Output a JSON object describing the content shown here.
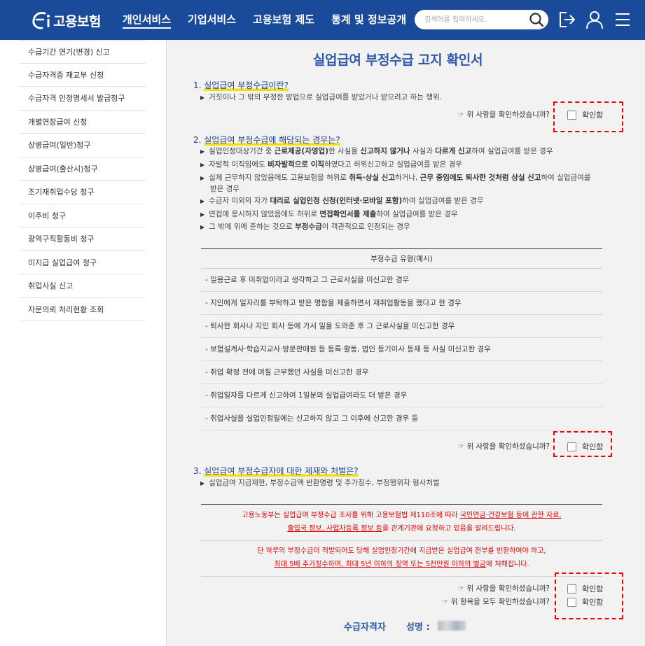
{
  "header": {
    "logo_text": "고용보험",
    "nav": [
      "개인서비스",
      "기업서비스",
      "고용보험 제도",
      "통계 및 정보공개"
    ],
    "search_placeholder": "검색어를 입력하세요."
  },
  "sidebar": {
    "items": [
      "수급기간 연기(변경) 신고",
      "수급자격증 재교부 신청",
      "수급자격 인정명세서 발급청구",
      "개별연장급여 신청",
      "상병급여(일반)청구",
      "상병급여(출산시)청구",
      "조기재취업수당 청구",
      "이주비 청구",
      "광역구직활동비 청구",
      "미지급 실업급여 청구",
      "취업사실 신고",
      "자문의뢰 처리현황 조회"
    ]
  },
  "main": {
    "title": "실업급여 부정수급 고지 확인서",
    "confirm_question": "☞ 위 사항을 확인하셨습니까?",
    "confirm_label": "확인함",
    "confirm_all_question": "☞ 위 항목을 모두 확인하셨습니까?",
    "section1": {
      "num": "1. ",
      "title": "실업급여 부정수급이란?",
      "bullets": [
        "거짓이나 그 밖의 부정한 방법으로 실업급여를 받았거나 받으려고 하는 행위."
      ]
    },
    "section2": {
      "num": "2. ",
      "title": "실업급여 부정수급에 해당되는 경우는?",
      "b1_a": "실업인정대상기간 중 ",
      "b1_b": "근로제공(자영업)",
      "b1_c": "한 사실을 ",
      "b1_d": "신고하지 않거나",
      "b1_e": " 사실과 ",
      "b1_f": "다르게 신고",
      "b1_g": "하여 실업급여를 받은 경우",
      "b2_a": "자발적 이직임에도 ",
      "b2_b": "비자발적으로 이직",
      "b2_c": "하였다고 허위신고하고 실업급여를 받은 경우",
      "b3_a": "실제 근무하지 않았음에도 고용보험을 허위로 ",
      "b3_b": "취득·상실 신고",
      "b3_c": "하거나, ",
      "b3_d": "근무 중임에도 퇴사한 것처럼 상실 신고",
      "b3_e": "하여 실업급여를",
      "b3_f": "받은 경우",
      "b4_a": "수급자 이외의 자가 ",
      "b4_b": "대리로 실업인정 신청",
      "b4_c": "(인터넷·모바일 포함)",
      "b4_d": "하여 실업급여를 받은 경우",
      "b5_a": "면접에 응시하지 않았음에도 허위로 ",
      "b5_b": "면접확인서를 제출",
      "b5_c": "하여 실업급여를 받은 경우",
      "b6_a": "그 밖에 위에 준하는 것으로 ",
      "b6_b": "부정수급",
      "b6_c": "이 객관적으로 인정되는 경우",
      "table_header": "부정수급 유형(예시)",
      "table_rows": [
        "- 일용근로 후 미취업이라고 생각하고 그 근로사실을 미신고한 경우",
        "- 지인에게 일자리를 부탁하고 받은 명함을 제출하면서 재취업활동을 했다고 한 경우",
        "- 퇴사한 회사나 지인 회사 등에 가서 일을 도와준 후 그 근로사실을 미신고한 경우",
        "- 보험설계사·학습지교사·방문판매원 등 등록·활동, 법인 등기이사 등재 등 사실 미신고한 경우",
        "- 취업 확정 전에 며칠 근무했던 사실을 미신고한 경우",
        "- 취업일자를 다르게 신고하여 1일분의 실업급여라도 더 받은 경우",
        "- 취업사실을 실업인정일에는 신고하지 않고 그 이후에 신고한 경우 등"
      ]
    },
    "section3": {
      "num": "3. ",
      "title": "실업급여 부정수급자에 대한 제재와 처벌은?",
      "bullets": [
        "실업급여 지급제한, 부정수급액 반환명령 및 추가징수, 부정행위자 형사처벌"
      ],
      "notice1_a": "고용노동부는 실업급여 부정수급 조사를 위해 고용보험법 제110조에 따라 ",
      "notice1_b": "국민연금·건강보험 등에 관한 자료,",
      "notice1_c": "출입국 정보, 사업자등록 정보 등",
      "notice1_d": "을 관계기관에 요청하고 있음을 알려드립니다.",
      "notice2_a": "단 하루의 부정수급이 적발되어도 당해 실업인정기간에 지급받은 실업급여 전부를 반환하여야 하고,",
      "notice2_b": "최대 5배 추가징수하며, 최대 5년 이하의 징역 또는 5천만원 이하의 벌금",
      "notice2_c": "에 처해집니다."
    },
    "sign": {
      "label": "수급자격자",
      "name_label": "성명 :"
    }
  },
  "colors": {
    "header_bg": "#1a4a9a",
    "title_blue": "#2d59a8",
    "highlight": "#f4e000",
    "notice_red": "#e00000"
  }
}
